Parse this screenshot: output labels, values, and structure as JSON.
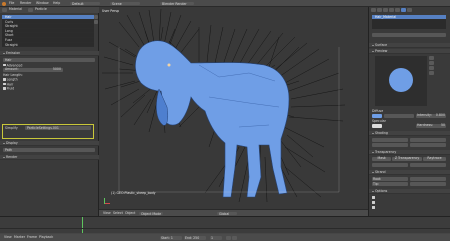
{
  "app": {
    "top_menus": [
      "File",
      "Render",
      "Window",
      "Help"
    ],
    "screen": "Default",
    "scene": "Scene",
    "engine": "Blender Render"
  },
  "left_panel": {
    "breadcrumb": [
      "Material",
      "Particle"
    ],
    "systems": [
      "Hair",
      "Curls",
      "Straight",
      "Long",
      "Short",
      "Fuzz",
      "Straight"
    ],
    "selected_system": "Hair",
    "section_title": "Emission",
    "type_value": "Hair",
    "checkbox_label": "Advanced",
    "amount_label": "Amount:",
    "amount_value": "5000",
    "hair_length_label": "Hair Length:",
    "opt_a": "Length",
    "opt_b": "Hair",
    "opt_c": "Fluid",
    "settings_name": "ParticleSettings.001",
    "highlight_label": "Simplify",
    "display_title": "Display",
    "display_value": "Path",
    "render_title": "Render"
  },
  "viewport": {
    "header_label": "User Persp",
    "object_label": "(1) GEO:Plastic_sheep_body",
    "bottom_menus": [
      "View",
      "Select",
      "Object"
    ],
    "mode": "Object Mode",
    "layer": "Global"
  },
  "right_panel": {
    "object_name": "Hair_Material",
    "section_a": "Surface",
    "section_b": "Preview",
    "diffuse_label": "Diffuse",
    "specular_label": "Specular",
    "shading_label": "Shading",
    "transparency_label": "Transparency",
    "intensity_label": "Intensity:",
    "intensity_value": "0.800",
    "hardness_label": "Hardness:",
    "hardness_value": "50",
    "tabs": [
      "Mask",
      "Z Transparency",
      "Raytrace"
    ],
    "strand_title": "Strand",
    "root_label": "Root:",
    "tip_label": "Tip:",
    "options_title": "Options"
  },
  "timeline": {
    "menus": [
      "View",
      "Marker",
      "Frame",
      "Playback"
    ],
    "start_label": "Start: 1",
    "end_label": "End: 250",
    "current_frame": "1"
  },
  "colors": {
    "accent": "#5680c2",
    "highlight_outline": "#c9c73a",
    "model": "#6f9ee6"
  }
}
